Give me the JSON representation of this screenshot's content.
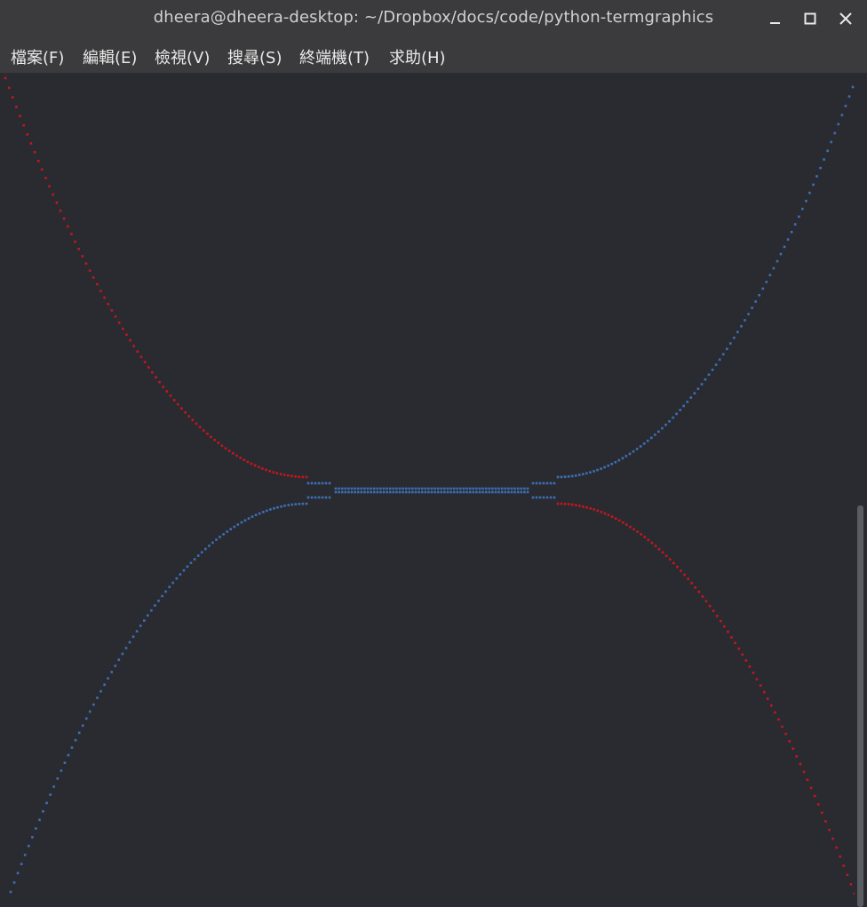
{
  "window": {
    "title": "dheera@dheera-desktop: ~/Dropbox/docs/code/python-termgraphics",
    "controls": [
      "minimize-icon",
      "maximize-icon",
      "close-icon"
    ]
  },
  "menu": {
    "items": [
      {
        "label": "檔案(F)"
      },
      {
        "label": "編輯(E)"
      },
      {
        "label": "檢視(V)"
      },
      {
        "label": "搜尋(S)"
      },
      {
        "label": "終端機(T)"
      },
      {
        "label": "求助(H)"
      }
    ]
  },
  "colors": {
    "background": "#2a2b31",
    "titlebar": "#3b3b3d",
    "red_series": "#c4171c",
    "blue_series": "#3c6fb5"
  },
  "chart_data": {
    "type": "scatter",
    "series": [
      {
        "color": "#c4171c",
        "shape": "upper-left and lower-right flare branches"
      },
      {
        "color": "#3c6fb5",
        "shape": "upper-right and lower-left flare branches with central neck"
      }
    ]
  }
}
